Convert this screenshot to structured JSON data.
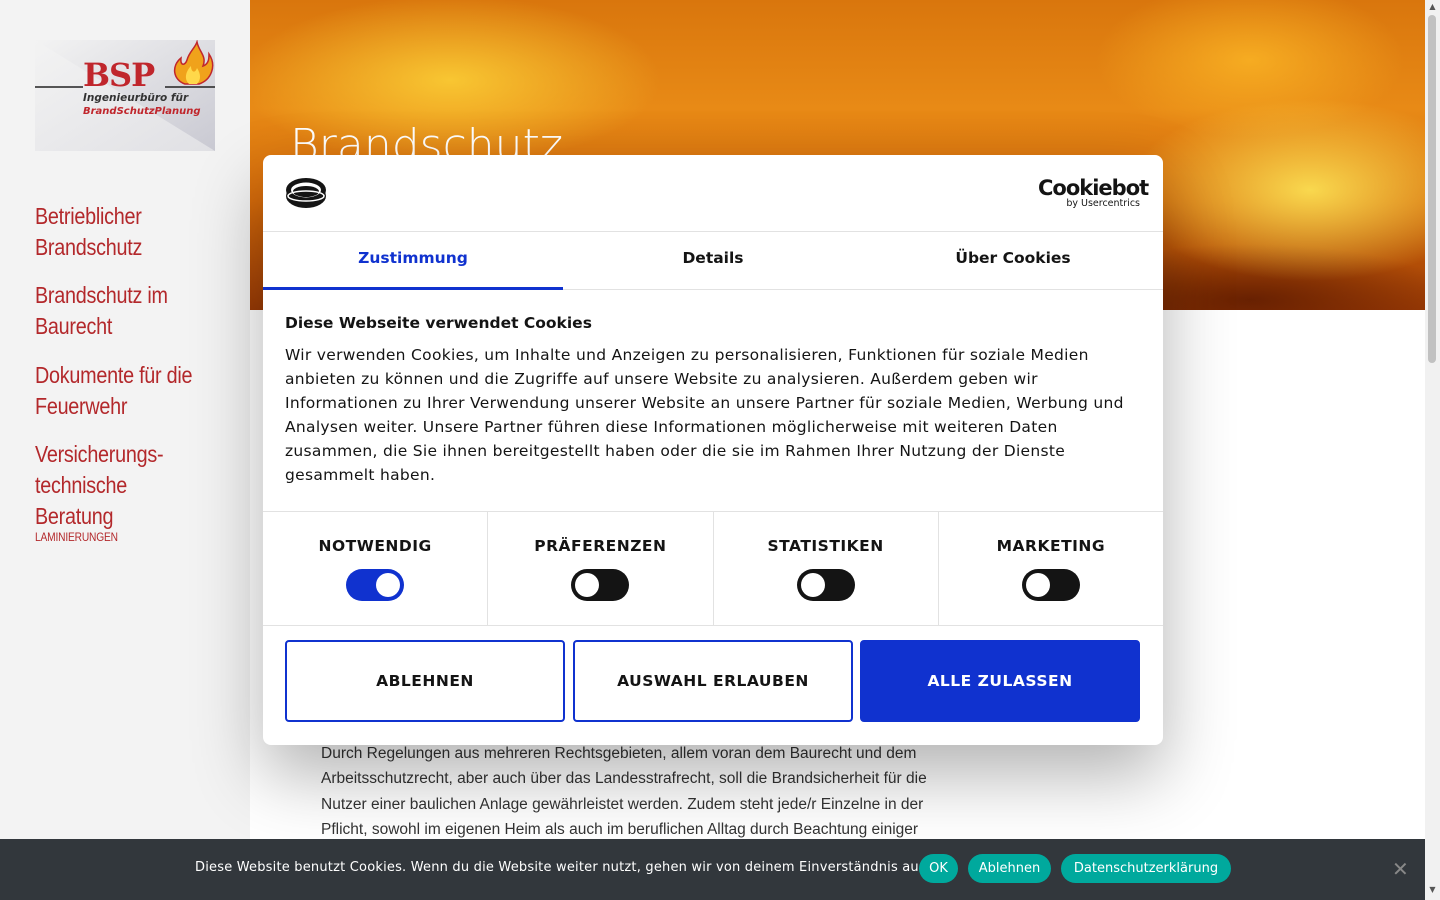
{
  "logo": {
    "text": "BSP",
    "line1": "Ingenieurbüro für",
    "line2": "BrandSchutzPlanung",
    "icon": "flame-logo"
  },
  "sidebar": {
    "items": [
      {
        "label_line1": "Betrieblicher",
        "label_line2": "Brandschutz"
      },
      {
        "label_line1": "Brandschutz im",
        "label_line2": "Baurecht"
      },
      {
        "label_line1": "Dokumente für die",
        "label_line2": "Feuerwehr"
      },
      {
        "label_line1": "Versicherungs-",
        "label_line2": "technische Beratung"
      }
    ],
    "small_item": "LAMINIERUNGEN"
  },
  "hero": {
    "title": "Brandschutz"
  },
  "body_text": "Durch Regelungen aus mehreren Rechtsgebieten, allem voran dem Baurecht und dem Arbeitsschutzrecht, aber auch über das Landesstrafrecht, soll die Brandsicherheit für die Nutzer einer baulichen Anlage gewährleistet werden. Zudem steht jede/r Einzelne in der Pflicht, sowohl im eigenen Heim als auch im beruflichen Alltag durch Beachtung einiger",
  "cookiebot": {
    "brand": "Cookiebot",
    "brand_sub": "by Usercentrics",
    "tabs": [
      "Zustimmung",
      "Details",
      "Über Cookies"
    ],
    "active_tab": "Zustimmung",
    "title": "Diese Webseite verwendet Cookies",
    "text": "Wir verwenden Cookies, um Inhalte und Anzeigen zu personalisieren, Funktionen für soziale Medien anbieten zu können und die Zugriffe auf unsere Website zu analysieren. Außerdem geben wir Informationen zu Ihrer Verwendung unserer Website an unsere Partner für soziale Medien, Werbung und Analysen weiter. Unsere Partner führen diese Informationen möglicherweise mit weiteren Daten zusammen, die Sie ihnen bereitgestellt haben oder die sie im Rahmen Ihrer Nutzung der Dienste gesammelt haben.",
    "categories": [
      {
        "label": "NOTWENDIG",
        "on": true
      },
      {
        "label": "PRÄFERENZEN",
        "on": false
      },
      {
        "label": "STATISTIKEN",
        "on": false
      },
      {
        "label": "MARKETING",
        "on": false
      }
    ],
    "buttons": {
      "reject": "ABLEHNEN",
      "allow_selection": "AUSWAHL ERLAUBEN",
      "allow_all": "ALLE ZULASSEN"
    },
    "accent_color": "#1032cf"
  },
  "cookie_bar": {
    "text": "Diese Website benutzt Cookies. Wenn du die Website weiter nutzt, gehen wir von deinem Einverständnis aus.",
    "ok": "OK",
    "decline": "Ablehnen",
    "privacy": "Datenschutzerklärung",
    "close": "✕",
    "button_color": "#00a99d"
  },
  "colors": {
    "nav_red": "#b3282b",
    "sidebar_bg": "#f3f3f3",
    "bar_bg": "#32373c"
  }
}
